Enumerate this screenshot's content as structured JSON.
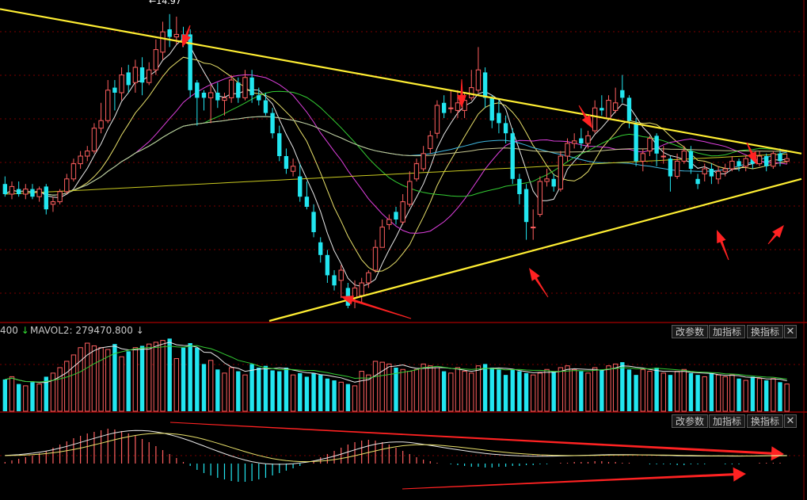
{
  "colors": {
    "up": "#ff5f5f",
    "down": "#22e6f0",
    "trend": "#ffee33",
    "arrow": "#ff2222",
    "grid": "#7a0000",
    "ma5": "#e8e8e8",
    "ma10": "#e8e06a",
    "ma20": "#e040e0",
    "ma30": "#33cc33",
    "ma60": "#40b8e0",
    "ma120": "#c8c890",
    "ma250": "#c8c820"
  },
  "volume_bar": {
    "left_fragment": "400",
    "left_arrow": "↓",
    "label": "MAVOL2: 279470.800",
    "right_arrow": "↓",
    "buttons": [
      "改参数",
      "加指标",
      "换指标"
    ],
    "close": "✕"
  },
  "macd_bar": {
    "buttons": [
      "改参数",
      "加指标",
      "换指标"
    ],
    "close": "✕"
  },
  "peak_label": "←14.97",
  "chart_data": {
    "type": "candlestick",
    "note_fields": "each candle = [open, close, high, low] in price units; volume in relative units; macd in relative units",
    "candles": [
      [
        8.4,
        8.0,
        8.7,
        7.9
      ],
      [
        8.0,
        8.3,
        8.5,
        7.8
      ],
      [
        8.2,
        8.0,
        8.5,
        7.9
      ],
      [
        8.0,
        8.2,
        8.4,
        7.8
      ],
      [
        8.2,
        7.9,
        8.4,
        7.8
      ],
      [
        7.9,
        8.2,
        8.3,
        7.7
      ],
      [
        8.3,
        7.4,
        8.4,
        7.2
      ],
      [
        7.6,
        7.7,
        7.9,
        7.3
      ],
      [
        7.7,
        8.1,
        8.2,
        7.6
      ],
      [
        8.1,
        8.6,
        8.8,
        8.0
      ],
      [
        8.6,
        9.2,
        9.4,
        8.5
      ],
      [
        9.2,
        9.5,
        9.7,
        9.0
      ],
      [
        9.5,
        9.7,
        9.9,
        9.3
      ],
      [
        9.7,
        10.6,
        10.8,
        9.6
      ],
      [
        10.6,
        10.9,
        11.6,
        10.4
      ],
      [
        10.9,
        12.1,
        12.5,
        10.8
      ],
      [
        12.2,
        12.0,
        12.5,
        11.3
      ],
      [
        12.0,
        12.7,
        13.0,
        11.7
      ],
      [
        12.8,
        12.3,
        13.1,
        12.0
      ],
      [
        12.4,
        13.0,
        13.3,
        12.0
      ],
      [
        13.0,
        12.4,
        13.4,
        11.9
      ],
      [
        12.4,
        12.9,
        13.2,
        12.3
      ],
      [
        12.9,
        13.7,
        14.1,
        12.7
      ],
      [
        13.6,
        14.4,
        14.8,
        13.3
      ],
      [
        14.5,
        14.2,
        15.1,
        13.8
      ],
      [
        14.2,
        14.3,
        15.0,
        13.9
      ],
      [
        14.3,
        14.1,
        14.6,
        13.8
      ],
      [
        14.3,
        12.1,
        14.5,
        11.8
      ],
      [
        12.4,
        11.8,
        12.5,
        10.7
      ],
      [
        12.0,
        11.8,
        12.1,
        11.3
      ],
      [
        11.8,
        12.0,
        12.3,
        10.8
      ],
      [
        12.0,
        11.7,
        12.4,
        11.4
      ],
      [
        11.7,
        11.8,
        12.0,
        11.1
      ],
      [
        11.8,
        12.5,
        12.7,
        11.6
      ],
      [
        12.4,
        11.8,
        12.6,
        11.6
      ],
      [
        11.8,
        12.6,
        12.9,
        11.7
      ],
      [
        12.6,
        11.9,
        12.9,
        11.6
      ],
      [
        11.9,
        11.7,
        12.2,
        11.5
      ],
      [
        11.7,
        11.2,
        12.0,
        11.1
      ],
      [
        11.2,
        10.4,
        11.4,
        10.2
      ],
      [
        10.4,
        9.5,
        10.7,
        9.3
      ],
      [
        9.5,
        9.0,
        9.8,
        8.8
      ],
      [
        8.9,
        9.1,
        9.4,
        8.7
      ],
      [
        8.7,
        7.9,
        9.2,
        7.7
      ],
      [
        7.9,
        7.5,
        8.5,
        7.4
      ],
      [
        7.3,
        6.5,
        7.6,
        6.3
      ],
      [
        6.1,
        5.6,
        6.3,
        5.3
      ],
      [
        5.6,
        4.8,
        5.8,
        4.5
      ],
      [
        4.8,
        4.4,
        5.0,
        4.2
      ],
      [
        4.6,
        5.0,
        5.2,
        3.9
      ],
      [
        4.3,
        3.6,
        4.5,
        3.5
      ],
      [
        3.9,
        4.3,
        4.6,
        3.5
      ],
      [
        4.0,
        4.5,
        4.7,
        3.7
      ],
      [
        4.5,
        4.9,
        5.0,
        4.3
      ],
      [
        5.0,
        5.9,
        6.2,
        4.9
      ],
      [
        5.9,
        6.7,
        7.0,
        5.9
      ],
      [
        6.8,
        7.0,
        7.2,
        6.6
      ],
      [
        7.3,
        7.0,
        7.5,
        6.8
      ],
      [
        6.9,
        7.7,
        8.0,
        6.8
      ],
      [
        7.6,
        8.5,
        8.9,
        7.5
      ],
      [
        8.6,
        9.2,
        9.4,
        8.5
      ],
      [
        9.0,
        9.6,
        9.9,
        8.9
      ],
      [
        9.8,
        10.3,
        10.5,
        9.6
      ],
      [
        10.4,
        11.5,
        11.7,
        10.2
      ],
      [
        11.6,
        11.2,
        11.9,
        11.0
      ],
      [
        11.4,
        11.4,
        12.1,
        11.2
      ],
      [
        11.3,
        11.6,
        12.1,
        11.0
      ],
      [
        11.3,
        11.7,
        12.0,
        11.0
      ],
      [
        11.8,
        12.2,
        12.9,
        11.7
      ],
      [
        12.1,
        12.9,
        13.8,
        12.0
      ],
      [
        12.8,
        11.8,
        13.0,
        11.4
      ],
      [
        11.8,
        10.9,
        11.9,
        10.6
      ],
      [
        11.2,
        10.8,
        11.7,
        10.4
      ],
      [
        10.8,
        10.4,
        11.1,
        10.0
      ],
      [
        10.4,
        8.6,
        10.6,
        8.4
      ],
      [
        8.6,
        8.0,
        8.8,
        7.6
      ],
      [
        8.2,
        6.9,
        8.4,
        6.2
      ],
      [
        6.7,
        6.7,
        7.4,
        6.2
      ],
      [
        7.2,
        8.5,
        8.7,
        7.1
      ],
      [
        8.5,
        8.6,
        9.0,
        8.3
      ],
      [
        8.6,
        8.3,
        8.8,
        8.1
      ],
      [
        8.2,
        9.5,
        9.7,
        8.1
      ],
      [
        9.5,
        10.0,
        10.2,
        9.3
      ],
      [
        10.0,
        10.1,
        10.4,
        9.8
      ],
      [
        10.2,
        10.0,
        10.6,
        9.8
      ],
      [
        10.0,
        10.3,
        10.5,
        9.8
      ],
      [
        10.5,
        11.4,
        11.7,
        10.4
      ],
      [
        11.4,
        11.3,
        11.9,
        11.1
      ],
      [
        11.0,
        11.7,
        11.9,
        10.9
      ],
      [
        11.3,
        11.6,
        12.2,
        11.2
      ],
      [
        12.1,
        11.8,
        12.7,
        11.6
      ],
      [
        11.8,
        10.9,
        11.9,
        10.6
      ],
      [
        10.8,
        9.3,
        11.0,
        9.1
      ],
      [
        9.3,
        9.6,
        9.8,
        8.9
      ],
      [
        9.7,
        10.2,
        10.3,
        9.5
      ],
      [
        10.3,
        9.6,
        10.4,
        9.1
      ],
      [
        9.5,
        9.5,
        9.9,
        9.2
      ],
      [
        9.4,
        8.7,
        9.5,
        8.1
      ],
      [
        8.7,
        9.3,
        9.6,
        8.6
      ],
      [
        9.3,
        9.7,
        9.9,
        9.2
      ],
      [
        9.7,
        9.0,
        9.9,
        8.8
      ],
      [
        8.6,
        8.4,
        8.8,
        8.2
      ],
      [
        8.8,
        9.0,
        9.2,
        8.5
      ],
      [
        9.0,
        8.7,
        9.2,
        8.4
      ],
      [
        8.6,
        8.9,
        9.1,
        8.4
      ],
      [
        8.9,
        9.0,
        9.2,
        8.7
      ],
      [
        9.0,
        9.3,
        9.5,
        8.9
      ],
      [
        9.3,
        9.1,
        9.4,
        8.9
      ],
      [
        9.1,
        9.4,
        9.5,
        8.9
      ],
      [
        9.4,
        9.2,
        9.6,
        9.0
      ],
      [
        9.2,
        9.5,
        9.7,
        9.1
      ],
      [
        9.5,
        9.1,
        9.6,
        8.9
      ],
      [
        9.1,
        9.6,
        9.7,
        9.0
      ],
      [
        9.6,
        9.3,
        9.8,
        9.1
      ],
      [
        9.3,
        9.4,
        9.6,
        9.2
      ]
    ],
    "volume": [
      35,
      38,
      30,
      28,
      32,
      30,
      38,
      42,
      48,
      55,
      62,
      70,
      75,
      72,
      70,
      68,
      74,
      60,
      66,
      70,
      72,
      74,
      76,
      78,
      80,
      58,
      70,
      75,
      70,
      52,
      56,
      46,
      42,
      48,
      44,
      40,
      52,
      48,
      50,
      45,
      44,
      48,
      40,
      42,
      38,
      42,
      40,
      36,
      34,
      32,
      30,
      28,
      44,
      40,
      55,
      54,
      52,
      48,
      46,
      44,
      46,
      52,
      50,
      48,
      44,
      42,
      48,
      44,
      42,
      50,
      52,
      48,
      46,
      40,
      46,
      44,
      42,
      40,
      42,
      46,
      44,
      48,
      50,
      46,
      44,
      42,
      48,
      46,
      50,
      52,
      54,
      46,
      40,
      46,
      44,
      48,
      42,
      40,
      44,
      46,
      42,
      40,
      38,
      42,
      40,
      38,
      40,
      36,
      34,
      38,
      36,
      34,
      36,
      32,
      30
    ],
    "macd": [
      2,
      4,
      6,
      8,
      10,
      13,
      16,
      20,
      24,
      28,
      32,
      35,
      38,
      40,
      42,
      44,
      43,
      41,
      38,
      35,
      31,
      27,
      22,
      17,
      12,
      7,
      2,
      -3,
      -8,
      -12,
      -15,
      -18,
      -20,
      -22,
      -23,
      -23,
      -22,
      -20,
      -18,
      -15,
      -12,
      -9,
      -6,
      -3,
      0,
      4,
      8,
      12,
      16,
      20,
      24,
      27,
      29,
      30,
      29,
      27,
      24,
      20,
      16,
      12,
      8,
      5,
      3,
      1,
      0,
      -1,
      -2,
      -3,
      -4,
      -4,
      -5,
      -5,
      -4,
      -4,
      -3,
      -3,
      -2,
      -2,
      -1,
      -1,
      0,
      1,
      1,
      2,
      2,
      2,
      3,
      3,
      2,
      2,
      1,
      1,
      0,
      0,
      -1,
      -1,
      -1,
      -1,
      -2,
      -2,
      -1,
      -1,
      -1,
      0,
      0,
      -1,
      -1,
      -1,
      0,
      0,
      1,
      1,
      1,
      1,
      0
    ]
  }
}
